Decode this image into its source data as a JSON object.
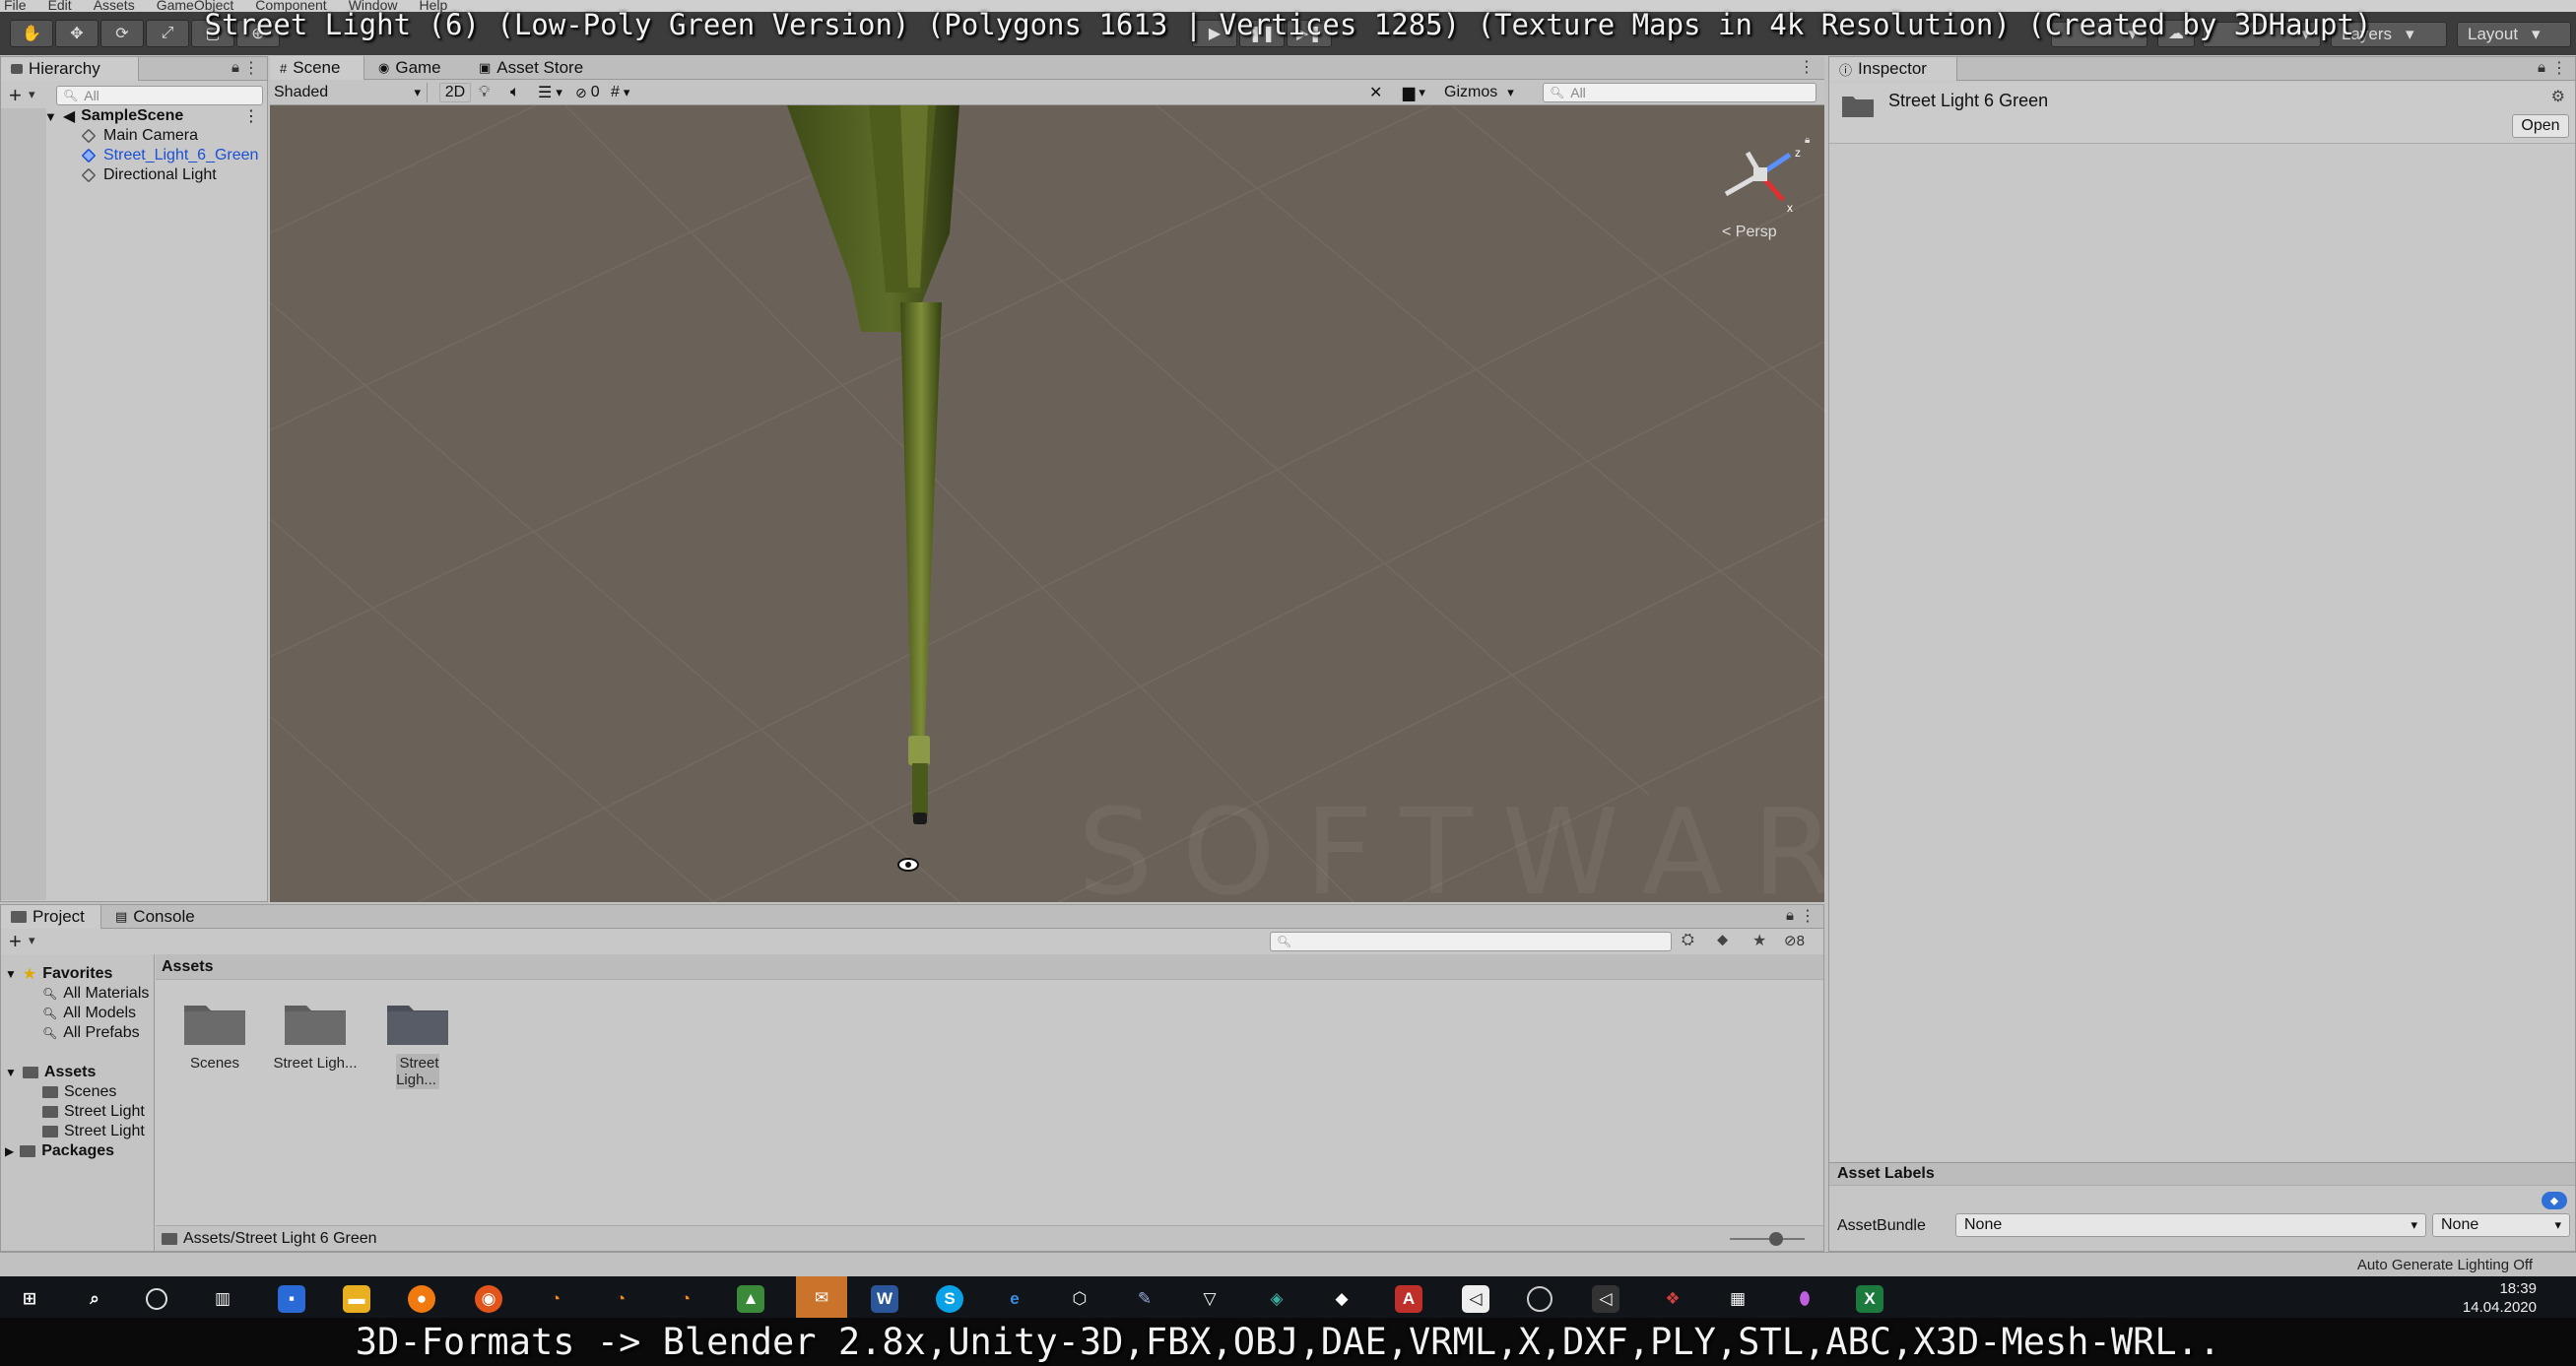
{
  "captions": {
    "top": "Street Light (6) (Low-Poly Green Version) (Polygons 1613 | Vertices 1285) (Texture Maps in 4k Resolution) (Created by 3DHaupt)",
    "bottom": "3D-Formats -> Blender 2.8x,Unity-3D,FBX,OBJ,DAE,VRML,X,DXF,PLY,STL,ABC,X3D-Mesh-WRL.."
  },
  "menu": [
    "File",
    "Edit",
    "Assets",
    "GameObject",
    "Component",
    "Window",
    "Help"
  ],
  "toolbar": {
    "layers": "Layers",
    "layout": "Layout"
  },
  "hierarchy": {
    "tab": "Hierarchy",
    "search_placeholder": "All",
    "scene": "SampleScene",
    "items": [
      "Main Camera",
      "Street_Light_6_Green",
      "Directional Light"
    ]
  },
  "scene_view": {
    "tabs": [
      "Scene",
      "Game",
      "Asset Store"
    ],
    "shading": "Shaded",
    "mode_2d": "2D",
    "hidden_count": "0",
    "gizmos": "Gizmos",
    "search_placeholder": "All",
    "projection": "Persp"
  },
  "inspector": {
    "tab": "Inspector",
    "asset_name": "Street Light 6 Green",
    "open_button": "Open",
    "asset_labels": "Asset Labels",
    "assetbundle_label": "AssetBundle",
    "assetbundle_value": "None",
    "variant_value": "None"
  },
  "project": {
    "tabs": [
      "Project",
      "Console"
    ],
    "favorites": "Favorites",
    "favorite_items": [
      "All Materials",
      "All Models",
      "All Prefabs"
    ],
    "assets_root": "Assets",
    "asset_tree": [
      "Scenes",
      "Street Light",
      "Street Light"
    ],
    "packages": "Packages",
    "header": "Assets",
    "grid_items": [
      "Scenes",
      "Street Ligh...",
      "Street Ligh..."
    ],
    "path": "Assets/Street Light 6 Green",
    "hidden_count": "8"
  },
  "status": {
    "lighting": "Auto Generate Lighting Off"
  },
  "taskbar": {
    "time": "18:39",
    "date": "14.04.2020"
  },
  "colors": {
    "scene_bg": "#6a6258",
    "pole_green": "#5b6a22",
    "selected_blue": "#1a4fd6",
    "toolbar_dark": "#3c3c3c"
  }
}
